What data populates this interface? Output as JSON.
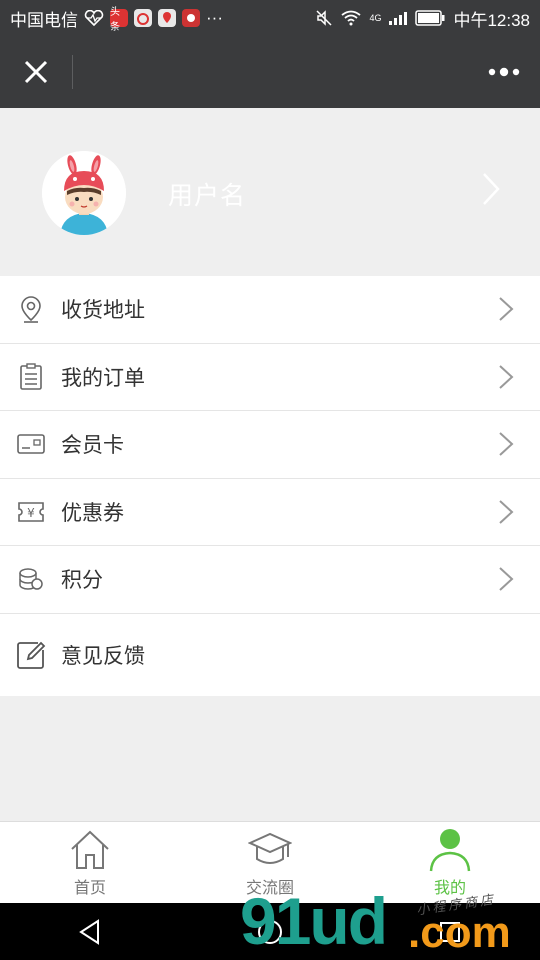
{
  "status_bar": {
    "carrier": "中国电信",
    "app_badge": "头条",
    "more_dots": "···",
    "network": "4G",
    "time": "中午12:38"
  },
  "title_bar": {
    "close_icon": "close-icon",
    "more_icon": "more-dots-icon"
  },
  "profile": {
    "username": "用户名",
    "avatar_icon": "bunny-avatar"
  },
  "menu": {
    "items": [
      {
        "label": "收货地址",
        "icon": "location-pin-icon"
      },
      {
        "label": "我的订单",
        "icon": "order-list-icon"
      },
      {
        "label": "会员卡",
        "icon": "member-card-icon"
      },
      {
        "label": "优惠券",
        "icon": "coupon-icon"
      },
      {
        "label": "积分",
        "icon": "coins-icon"
      },
      {
        "label": "意见反馈",
        "icon": "feedback-edit-icon"
      }
    ]
  },
  "tabbar": {
    "tabs": [
      {
        "label": "首页",
        "icon": "home-icon"
      },
      {
        "label": "交流圈",
        "icon": "graduation-cap-icon"
      },
      {
        "label": "我的",
        "icon": "user-icon"
      }
    ],
    "active_index": 2
  },
  "watermark": {
    "main": "91ud",
    "suffix": ".com",
    "tagline": "小程序商店"
  },
  "colors": {
    "dark_bar": "#3a3b3d",
    "accent_green": "#5cc245",
    "background": "#efefef"
  }
}
